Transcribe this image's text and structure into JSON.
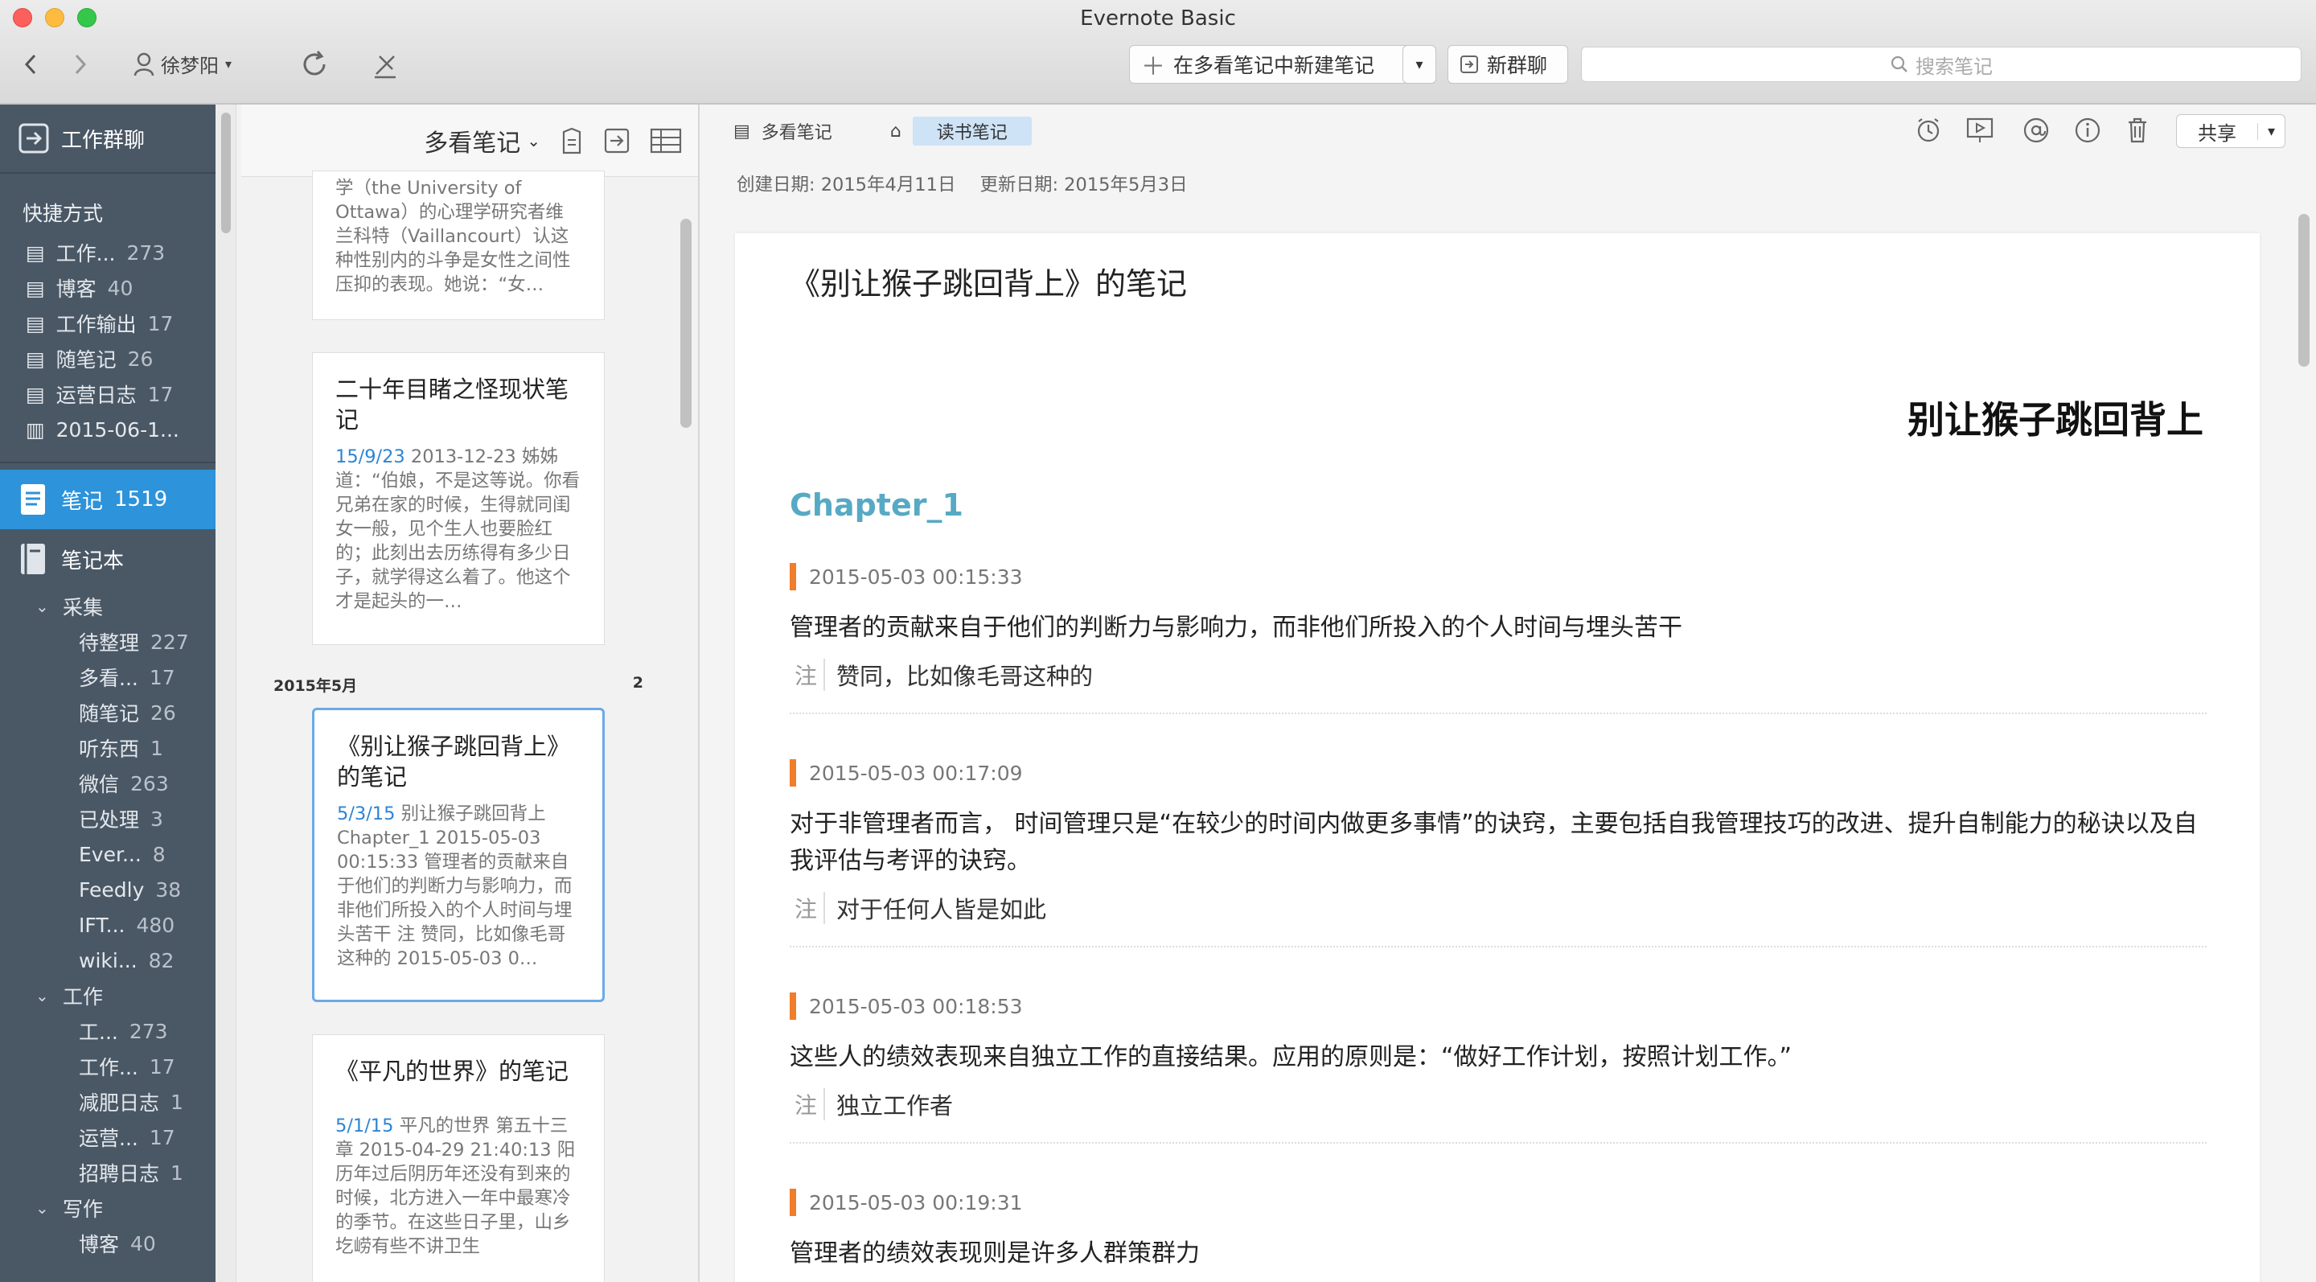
{
  "window": {
    "title": "Evernote Basic"
  },
  "toolbar": {
    "user": "徐梦阳",
    "new_note": "在多看笔记中新建笔记",
    "new_chat": "新群聊",
    "search_placeholder": "搜索笔记"
  },
  "sidebar": {
    "work_chat": "工作群聊",
    "shortcuts_label": "快捷方式",
    "shortcuts": [
      {
        "label": "工作...",
        "count": "273"
      },
      {
        "label": "博客",
        "count": "40"
      },
      {
        "label": "工作输出",
        "count": "17"
      },
      {
        "label": "随笔记",
        "count": "26"
      },
      {
        "label": "运营日志",
        "count": "17"
      },
      {
        "label": "2015-06-1...",
        "count": ""
      }
    ],
    "notes_label": "笔记",
    "notes_count": "1519",
    "notebooks_label": "笔记本",
    "groups": [
      {
        "label": "采集",
        "items": [
          {
            "label": "待整理",
            "count": "227"
          },
          {
            "label": "多看...",
            "count": "17"
          },
          {
            "label": "随笔记",
            "count": "26"
          },
          {
            "label": "听东西",
            "count": "1"
          },
          {
            "label": "微信",
            "count": "263"
          },
          {
            "label": "已处理",
            "count": "3"
          },
          {
            "label": "Ever...",
            "count": "8"
          },
          {
            "label": "Feedly",
            "count": "38"
          },
          {
            "label": "IFT...",
            "count": "480"
          },
          {
            "label": "wiki...",
            "count": "82"
          }
        ]
      },
      {
        "label": "工作",
        "items": [
          {
            "label": "工...",
            "count": "273"
          },
          {
            "label": "工作...",
            "count": "17"
          },
          {
            "label": "减肥日志",
            "count": "1"
          },
          {
            "label": "运营...",
            "count": "17"
          },
          {
            "label": "招聘日志",
            "count": "1"
          }
        ]
      },
      {
        "label": "写作",
        "items": [
          {
            "label": "博客",
            "count": "40"
          }
        ]
      }
    ]
  },
  "list": {
    "notebook": "多看笔记",
    "month_label": "2015年5月",
    "month_count": "2",
    "cards": [
      {
        "title": "",
        "date": "",
        "snippet": "学（the University of Ottawa）的心理学研究者维兰科特（Vaillancourt）认这种性别内的斗争是女性之间性压抑的表现。她说：“女…"
      },
      {
        "title": "二十年目睹之怪现状笔记",
        "date": "15/9/23",
        "snippet": " 2013-12-23 姊姊道：“伯娘，不是这等说。你看兄弟在家的时候，生得就同闺女一般，见个生人也要脸红的；此刻出去历练得有多少日子，就学得这么着了。他这个才是起头的一…"
      },
      {
        "title": "《别让猴子跳回背上》的笔记",
        "date": "5/3/15",
        "snippet": " 别让猴子跳回背上 Chapter_1 2015-05-03 00:15:33 管理者的贡献来自于他们的判断力与影响力，而非他们所投入的个人时间与埋头苦干 注 赞同，比如像毛哥这种的 2015-05-03 0…"
      },
      {
        "title": "《平凡的世界》的笔记",
        "date": "5/1/15",
        "snippet": " 平凡的世界 第五十三章 2015-04-29 21:40:13 阳历年过后阴历年还没有到来的时候，北方进入一年中最寒冷的季节。在这些日子里，山乡圪崂有些不讲卫生"
      }
    ]
  },
  "detail": {
    "notebook": "多看笔记",
    "tag": "读书笔记",
    "share": "共享",
    "created": "创建日期: 2015年4月11日",
    "updated": "更新日期: 2015年5月3日",
    "note_title": "《别让猴子跳回背上》的笔记",
    "book_title": "别让猴子跳回背上",
    "chapter": "Chapter_1",
    "note_marker": "注",
    "entries": [
      {
        "time": "2015-05-03 00:15:33",
        "quote": "管理者的贡献来自于他们的判断力与影响力，而非他们所投入的个人时间与埋头苦干",
        "note": "赞同，比如像毛哥这种的"
      },
      {
        "time": "2015-05-03 00:17:09",
        "quote": "对于非管理者而言， 时间管理只是“在较少的时间内做更多事情”的诀窍，主要包括自我管理技巧的改进、提升自制能力的秘诀以及自我评估与考评的诀窍。",
        "note": "对于任何人皆是如此"
      },
      {
        "time": "2015-05-03 00:18:53",
        "quote": "这些人的绩效表现来自独立工作的直接结果。应用的原则是：“做好工作计划，按照计划工作。”",
        "note": "独立工作者"
      },
      {
        "time": "2015-05-03 00:19:31",
        "quote": "管理者的绩效表现则是许多人群策群力",
        "note": ""
      }
    ]
  }
}
